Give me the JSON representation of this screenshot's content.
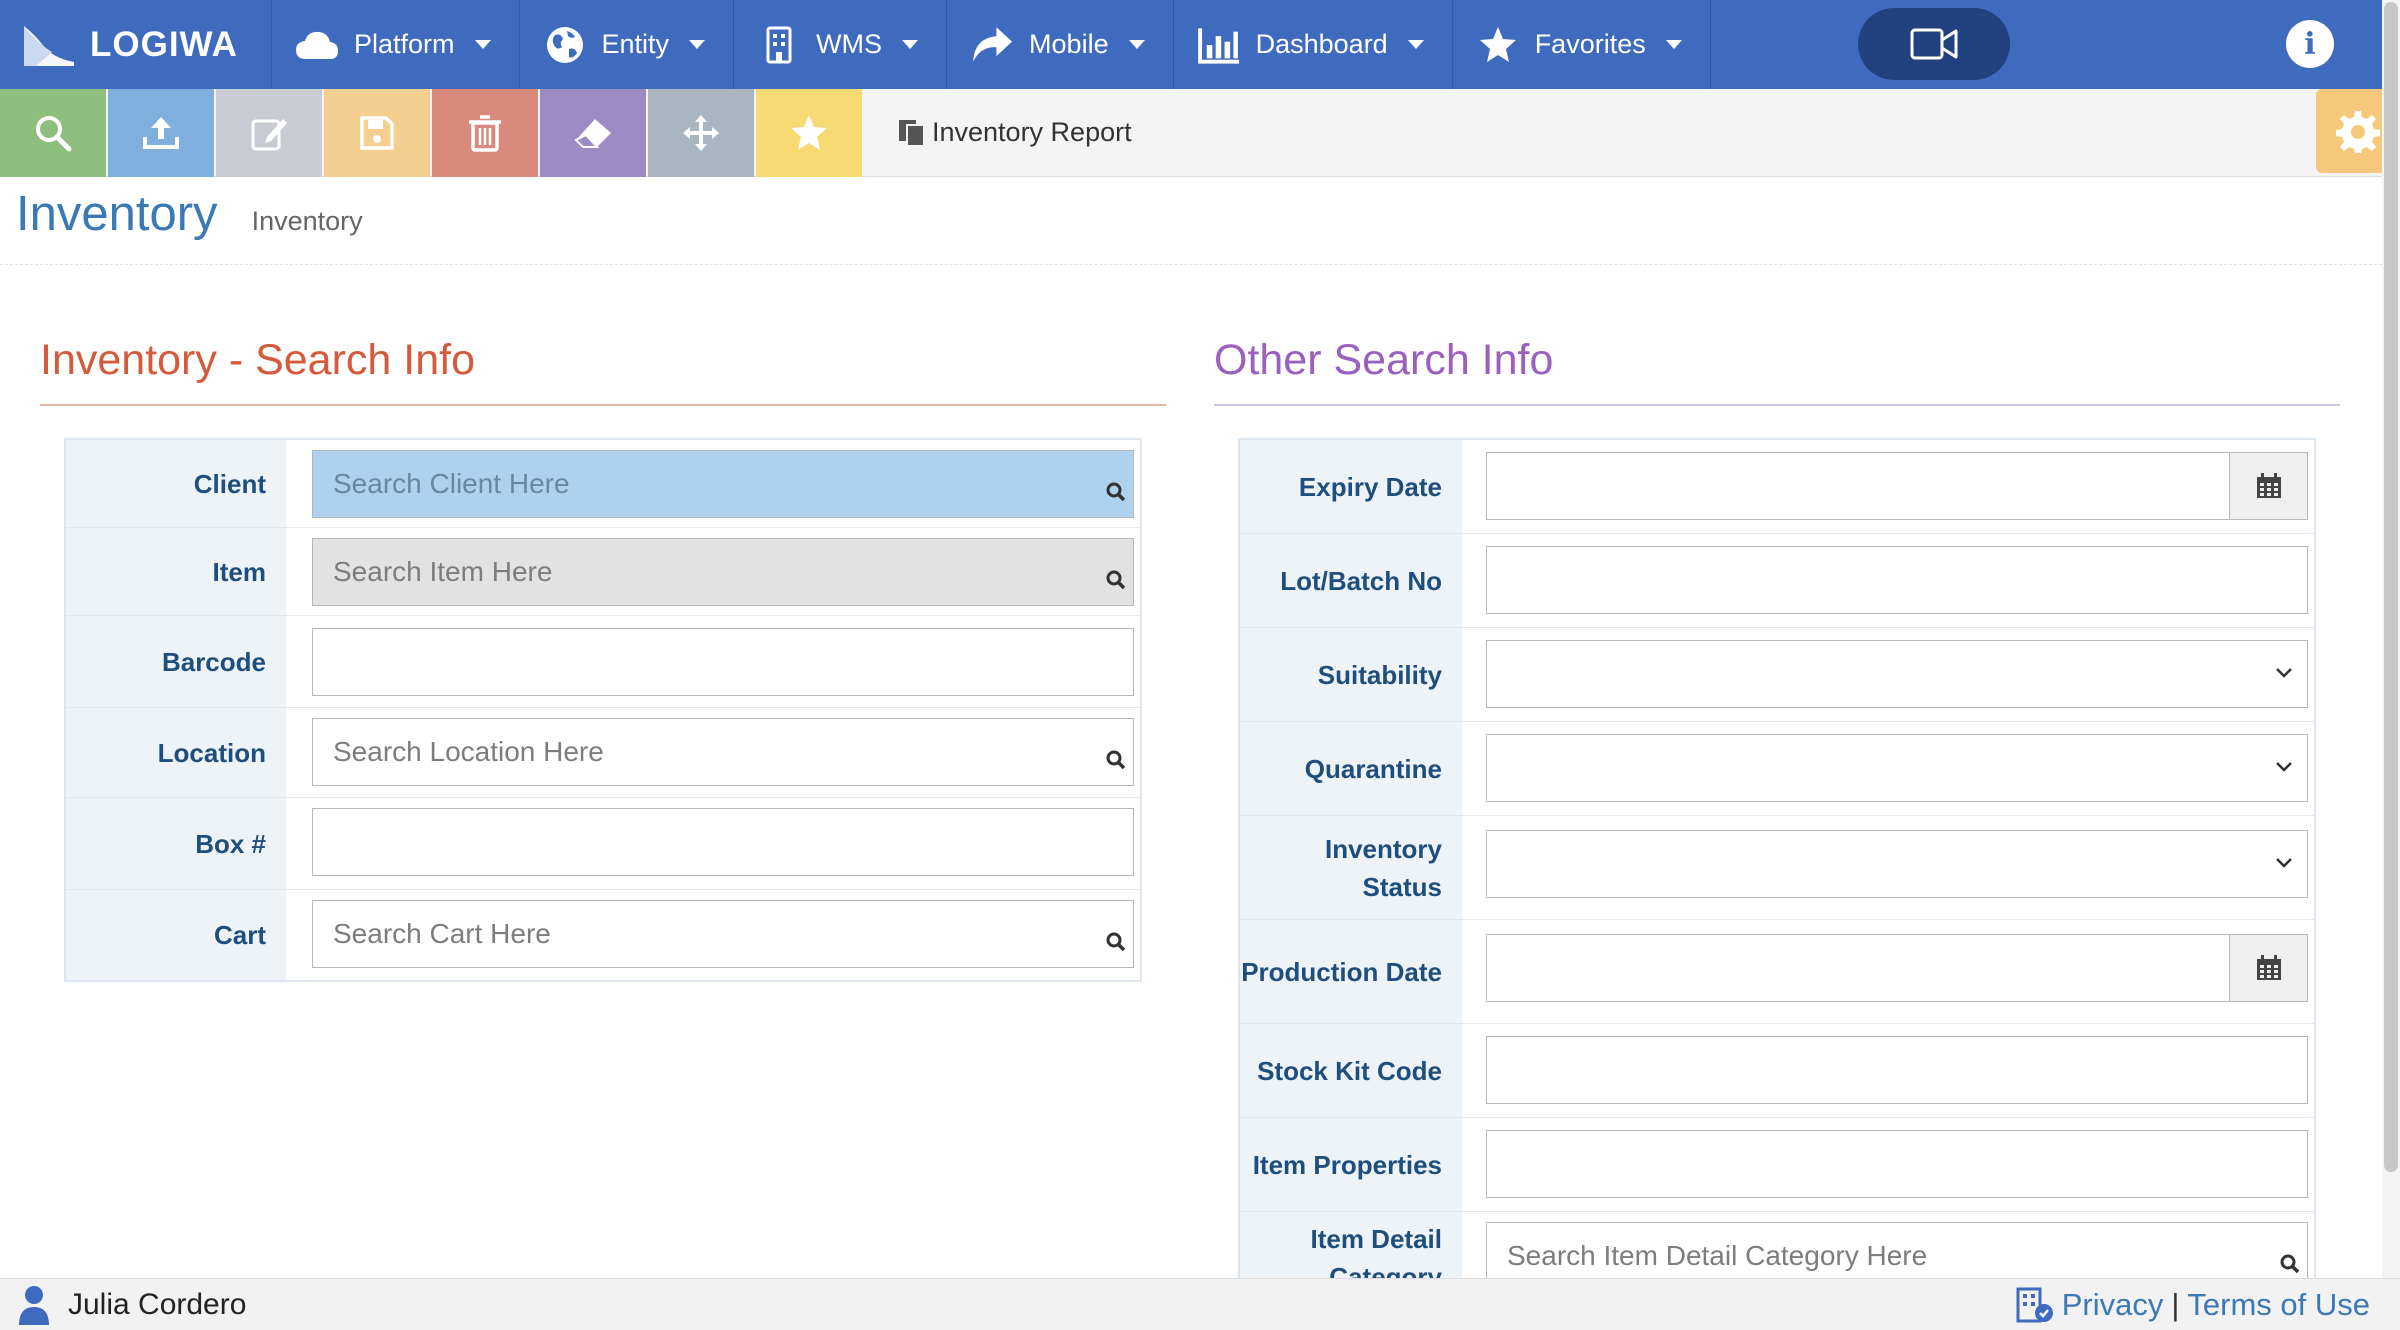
{
  "brand": {
    "name": "LOGIWA"
  },
  "nav": {
    "items": [
      {
        "label": "Platform",
        "icon": "cloud-icon"
      },
      {
        "label": "Entity",
        "icon": "globe-icon"
      },
      {
        "label": "WMS",
        "icon": "building-icon"
      },
      {
        "label": "Mobile",
        "icon": "share-arrow-icon"
      },
      {
        "label": "Dashboard",
        "icon": "bar-chart-icon"
      },
      {
        "label": "Favorites",
        "icon": "star-icon"
      }
    ],
    "info_label": "i"
  },
  "toolbar": {
    "buttons": [
      {
        "name": "search",
        "icon": "search-icon",
        "color": "#8fbf7f"
      },
      {
        "name": "upload",
        "icon": "upload-icon",
        "color": "#7fb0dd"
      },
      {
        "name": "edit",
        "icon": "edit-icon",
        "color": "#c8ccd2"
      },
      {
        "name": "save",
        "icon": "save-icon",
        "color": "#f5cf8f"
      },
      {
        "name": "delete",
        "icon": "trash-icon",
        "color": "#d98a7c"
      },
      {
        "name": "erase",
        "icon": "eraser-icon",
        "color": "#9b8ac4"
      },
      {
        "name": "move",
        "icon": "move-icon",
        "color": "#a9b5bf"
      },
      {
        "name": "favorite",
        "icon": "star-icon",
        "color": "#f7da72"
      }
    ],
    "report_label": "Inventory Report"
  },
  "page": {
    "title": "Inventory",
    "subtitle": "Inventory"
  },
  "left_section": {
    "title": "Inventory - Search Info",
    "fields": [
      {
        "label": "Client",
        "value": "",
        "placeholder": "Search Client Here"
      },
      {
        "label": "Item",
        "value": "",
        "placeholder": "Search Item Here"
      },
      {
        "label": "Barcode",
        "value": "",
        "placeholder": ""
      },
      {
        "label": "Location",
        "value": "",
        "placeholder": "Search Location Here"
      },
      {
        "label": "Box #",
        "value": "",
        "placeholder": ""
      },
      {
        "label": "Cart",
        "value": "",
        "placeholder": "Search Cart Here"
      }
    ]
  },
  "right_section": {
    "title": "Other Search Info",
    "fields": [
      {
        "label": "Expiry Date",
        "value": ""
      },
      {
        "label": "Lot/Batch No",
        "value": ""
      },
      {
        "label": "Suitability",
        "value": ""
      },
      {
        "label": "Quarantine",
        "value": ""
      },
      {
        "label": "Inventory Status",
        "value": ""
      },
      {
        "label": "Production Date",
        "value": ""
      },
      {
        "label": "Stock Kit Code",
        "value": ""
      },
      {
        "label": "Item Properties",
        "value": ""
      },
      {
        "label": "Item Detail Category",
        "value": "",
        "placeholder": "Search Item Detail Category Here"
      }
    ]
  },
  "footer": {
    "user_name": "Julia Cordero",
    "privacy_label": "Privacy",
    "separator": "|",
    "terms_label": "Terms of Use"
  },
  "colors": {
    "nav_bg": "#3f6bbf",
    "left_title": "#d45a3b",
    "right_title": "#9b5fc0",
    "label_text": "#1e4e7e",
    "label_bg": "#eef3f7"
  }
}
